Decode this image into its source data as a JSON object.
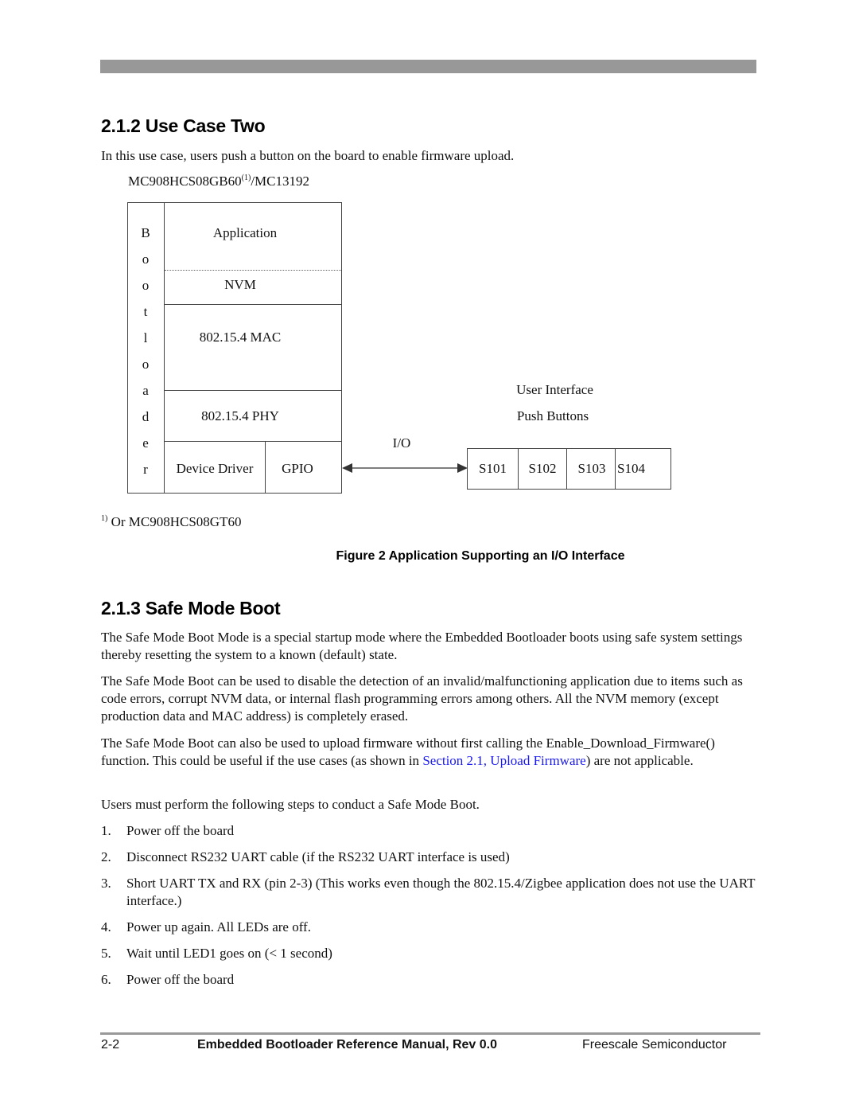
{
  "header": {
    "bar": "decorative"
  },
  "section_212": {
    "title": "2.1.2 Use Case Two",
    "intro": "In this use case, users push a button on the board to enable firmware upload.",
    "chip_label": "MC908HCS08GB60",
    "chip_sup": "(1)",
    "chip_suffix": "/MC13192"
  },
  "diagram": {
    "bootloader_letters": [
      "B",
      "o",
      "o",
      "t",
      "l",
      "o",
      "a",
      "d",
      "e",
      "r"
    ],
    "layers": {
      "application": "Application",
      "nvm": "NVM",
      "mac": "802.15.4 MAC",
      "phy": "802.15.4 PHY",
      "device_driver": "Device Driver",
      "gpio": "GPIO"
    },
    "io_label": "I/O",
    "user_interface": "User Interface",
    "push_buttons": "Push Buttons",
    "buttons": [
      "S101",
      "S102",
      "S103",
      "S104"
    ],
    "footnote_mark": "1)",
    "footnote_text": "Or MC908HCS08GT60"
  },
  "figure_caption": "Figure 2 Application Supporting an I/O Interface",
  "section_213": {
    "title": "2.1.3 Safe Mode Boot",
    "para1": "The Safe Mode Boot Mode is a special startup mode where the Embedded Bootloader boots using safe system settings thereby resetting the system to a known (default) state.",
    "para2": "The Safe Mode Boot can be used to disable the detection of an invalid/malfunctioning application due to items such as code errors, corrupt NVM data, or internal flash programming errors among others. All the NVM memory (except production data and MAC address) is completely erased.",
    "para3_a": "The Safe Mode Boot can also be used to upload firmware without first calling the Enable_Download_Firmware() function. This could be useful if the use cases (as shown in ",
    "para3_link": "Section  2.1, Upload Firmware",
    "para3_b": ") are not applicable.",
    "para4": "Users must perform the following steps to conduct a Safe Mode Boot.",
    "steps": [
      {
        "num": "1.",
        "text": "Power off the board"
      },
      {
        "num": "2.",
        "text": "Disconnect RS232 UART cable (if the RS232 UART interface is used)"
      },
      {
        "num": "3.",
        "text": "Short UART TX and RX (pin 2-3) (This works even though the 802.15.4/Zigbee application does not use the UART interface.)"
      },
      {
        "num": "4.",
        "text": "Power up again. All LEDs are off."
      },
      {
        "num": "5.",
        "text": "Wait until LED1 goes on (< 1 second)"
      },
      {
        "num": "6.",
        "text": "Power off the board"
      }
    ]
  },
  "footer": {
    "page": "2-2",
    "title": "Embedded Bootloader Reference Manual, Rev 0.0",
    "company": "Freescale Semiconductor"
  },
  "colors": {
    "link": "#1a1aee",
    "bar": "#989898"
  }
}
